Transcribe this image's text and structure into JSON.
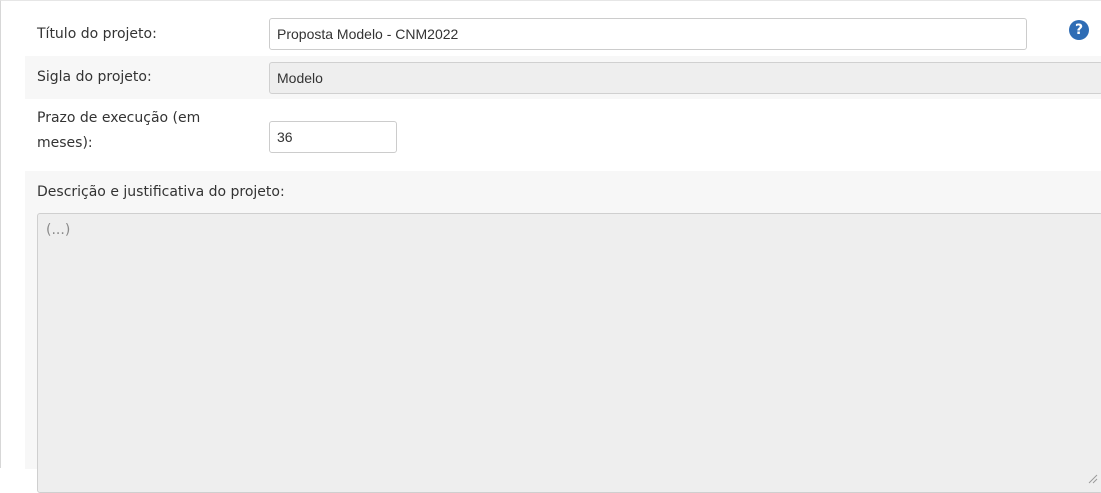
{
  "form": {
    "title": {
      "label": "Título do projeto:",
      "value": "Proposta Modelo - CNM2022",
      "help_icon": "help-question-icon",
      "help_glyph": "?"
    },
    "sigla": {
      "label": "Sigla do projeto:",
      "value": "Modelo"
    },
    "prazo": {
      "label": "Prazo de execução (em meses):",
      "value": "36"
    },
    "descricao": {
      "label": "Descrição e justificativa do projeto:",
      "value": "(...)"
    }
  },
  "colors": {
    "help_icon": "#2f6db5",
    "row_alt": "#f7f7f7",
    "readonly_field": "#eeeeee"
  }
}
